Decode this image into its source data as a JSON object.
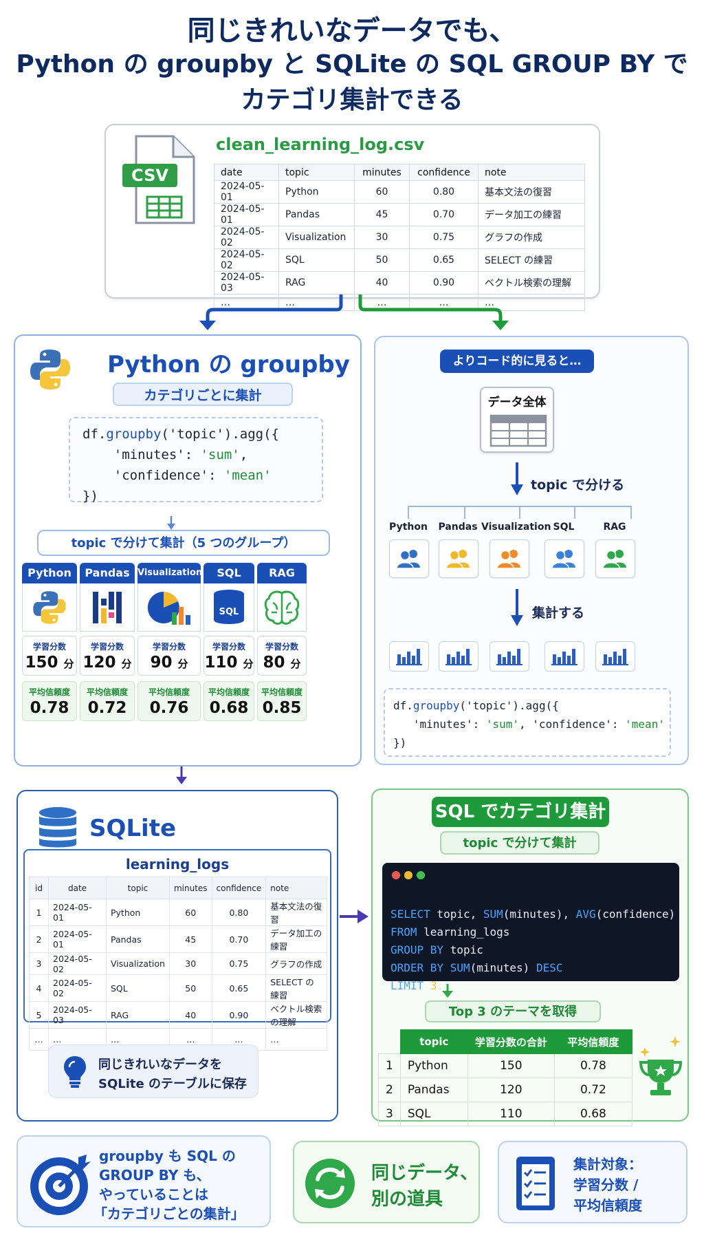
{
  "title": {
    "line1": "同じきれいなデータでも、",
    "line2": "Python の groupby と SQLite の SQL GROUP BY で",
    "line3": "カテゴリ集計できる"
  },
  "csv": {
    "badge": "CSV",
    "filename": "clean_learning_log.csv",
    "headers": [
      "date",
      "topic",
      "minutes",
      "confidence",
      "note"
    ],
    "rows": [
      [
        "2024-05-01",
        "Python",
        "60",
        "0.80",
        "基本文法の復習"
      ],
      [
        "2024-05-01",
        "Pandas",
        "45",
        "0.70",
        "データ加工の練習"
      ],
      [
        "2024-05-02",
        "Visualization",
        "30",
        "0.75",
        "グラフの作成"
      ],
      [
        "2024-05-02",
        "SQL",
        "50",
        "0.65",
        "SELECT の練習"
      ],
      [
        "2024-05-03",
        "RAG",
        "40",
        "0.90",
        "ベクトル検索の理解"
      ],
      [
        "…",
        "…",
        "…",
        "…",
        "…"
      ]
    ]
  },
  "python_panel": {
    "title": "Python の groupby",
    "subtitle": "カテゴリごとに集計",
    "code": {
      "l1a": "df.",
      "l1b": "groupby",
      "l1c": "('topic').agg({",
      "l2a": "    'minutes': ",
      "l2b": "'sum'",
      "l2c": ",",
      "l3a": "    'confidence': ",
      "l3b": "'mean'",
      "l4": "})"
    },
    "split_label": "topic で分けて集計（5 つのグループ）",
    "min_label": "学習分数",
    "conf_label": "平均信頼度",
    "unit": "分",
    "groups": [
      {
        "name": "Python",
        "minutes": "150",
        "confidence": "0.78"
      },
      {
        "name": "Pandas",
        "minutes": "120",
        "confidence": "0.72"
      },
      {
        "name": "Visualization",
        "minutes": "90",
        "confidence": "0.76"
      },
      {
        "name": "SQL",
        "minutes": "110",
        "confidence": "0.68"
      },
      {
        "name": "RAG",
        "minutes": "80",
        "confidence": "0.85"
      }
    ]
  },
  "code_view": {
    "badge": "よりコード的に見ると…",
    "all_data": "データ全体",
    "split": "topic で分ける",
    "aggregate": "集計する",
    "topics": [
      "Python",
      "Pandas",
      "Visualization",
      "SQL",
      "RAG"
    ],
    "code": {
      "l1a": "df.",
      "l1b": "groupby",
      "l1c": "('topic').agg({",
      "l2a": "   'minutes': ",
      "l2b": "'sum'",
      "l2c": ", 'confidence': ",
      "l2d": "'mean'",
      "l3": "})"
    }
  },
  "sqlite": {
    "title": "SQLite",
    "table_name": "learning_logs",
    "headers": [
      "id",
      "date",
      "topic",
      "minutes",
      "confidence",
      "note"
    ],
    "rows": [
      [
        "1",
        "2024-05-01",
        "Python",
        "60",
        "0.80",
        "基本文法の復習"
      ],
      [
        "2",
        "2024-05-01",
        "Pandas",
        "45",
        "0.70",
        "データ加工の練習"
      ],
      [
        "3",
        "2024-05-02",
        "Visualization",
        "30",
        "0.75",
        "グラフの作成"
      ],
      [
        "4",
        "2024-05-02",
        "SQL",
        "50",
        "0.65",
        "SELECT の練習"
      ],
      [
        "5",
        "2024-05-03",
        "RAG",
        "40",
        "0.90",
        "ベクトル検索の理解"
      ],
      [
        "…",
        "…",
        "…",
        "…",
        "…",
        "…"
      ]
    ],
    "note_line1": "同じきれいなデータを",
    "note_line2": "SQLite のテーブルに保存"
  },
  "sql_panel": {
    "title": "SQL でカテゴリ集計",
    "subtitle": "topic で分けて集計",
    "code": {
      "l1a": "SELECT",
      "l1b": " topic, ",
      "l1c": "SUM",
      "l1d": "(minutes), ",
      "l1e": "AVG",
      "l1f": "(confidence)",
      "l2a": "FROM",
      "l2b": " learning_logs",
      "l3a": "GROUP BY",
      "l3b": " topic",
      "l4a": "ORDER BY",
      "l4b": " ",
      "l4c": "SUM",
      "l4d": "(minutes) ",
      "l4e": "DESC",
      "l5a": "LIMIT",
      "l5b": " ",
      "l5c": "3",
      "l5d": ";"
    },
    "result_label": "Top 3 のテーマを取得",
    "headers": [
      "topic",
      "学習分数の合計",
      "平均信頼度"
    ],
    "rows": [
      [
        "1",
        "Python",
        "150",
        "0.78"
      ],
      [
        "2",
        "Pandas",
        "120",
        "0.72"
      ],
      [
        "3",
        "SQL",
        "110",
        "0.68"
      ]
    ]
  },
  "footer": {
    "card1": [
      "groupby も SQL の",
      "GROUP BY も、",
      "やっていることは",
      "「カテゴリごとの集計」"
    ],
    "card2": [
      "同じデータ、",
      "別の道具"
    ],
    "card3": [
      "集計対象：",
      "学習分数 /",
      "平均信頼度"
    ]
  },
  "colors": {
    "navy": "#0d2a60",
    "blue": "#1a4fb5",
    "green": "#1f9a3a",
    "code_bg": "#0f1726"
  }
}
